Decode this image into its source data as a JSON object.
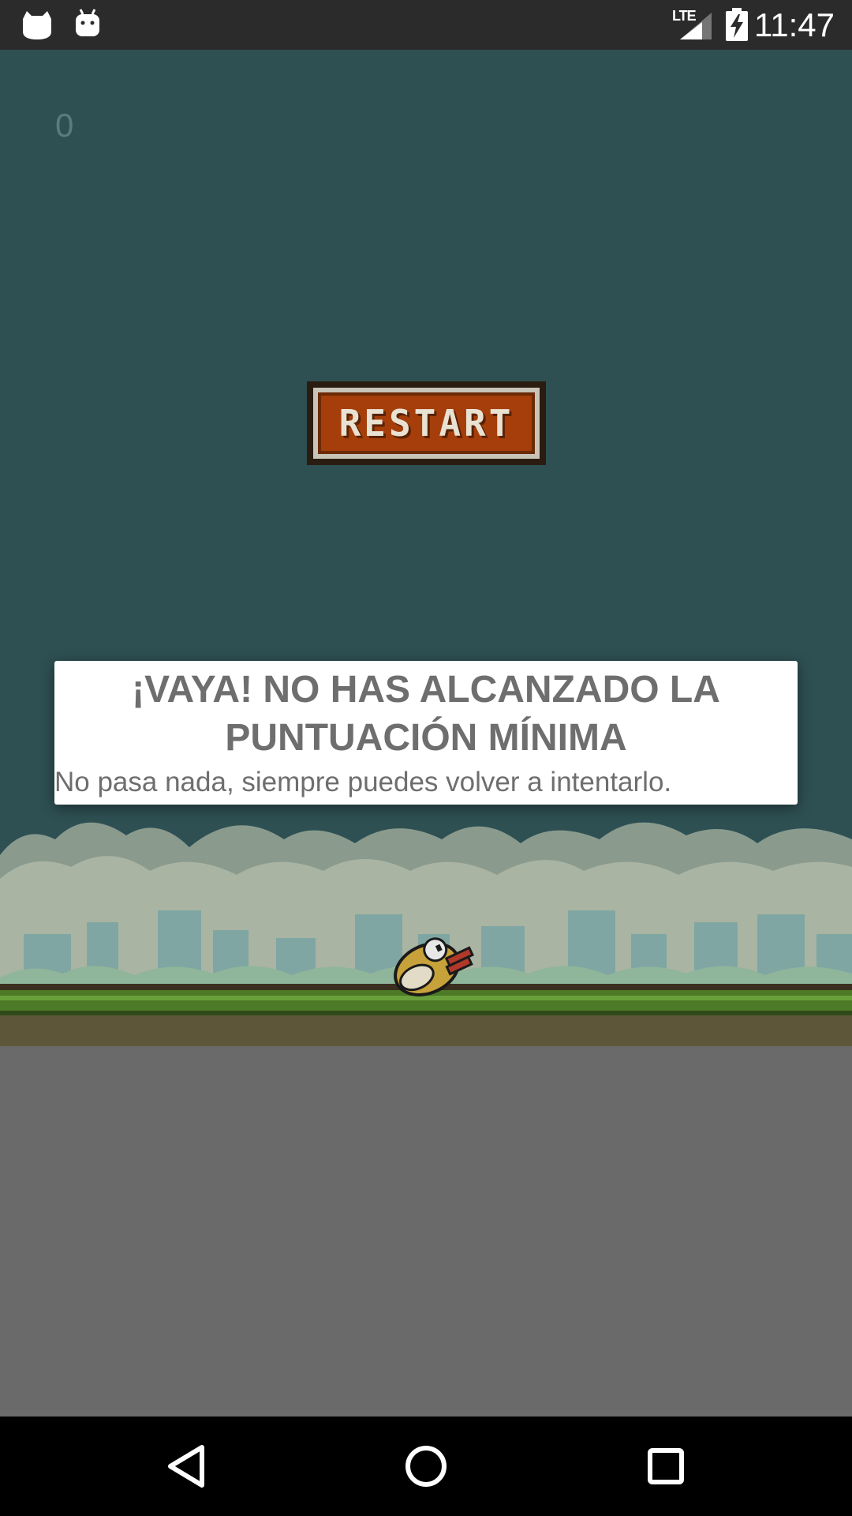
{
  "status_bar": {
    "time": "11:47",
    "network": "LTE",
    "icons": [
      "cat-notification-icon",
      "android-notification-icon",
      "signal-icon",
      "battery-charging-icon"
    ]
  },
  "game": {
    "score": "0",
    "restart_label": "RESTART"
  },
  "dialog": {
    "title": "¡VAYA! NO HAS ALCANZADO LA PUNTUACIÓN MÍNIMA",
    "message": "No pasa nada, siempre puedes volver a intentarlo."
  },
  "navbar": {
    "icons": [
      "back-icon",
      "home-icon",
      "recents-icon"
    ]
  },
  "colors": {
    "sky": "#2e5053",
    "restart_button": "#a53e0a",
    "ground": "#5e5638",
    "grass": "#4d7a26",
    "dialog_text": "#6e6e6e"
  }
}
